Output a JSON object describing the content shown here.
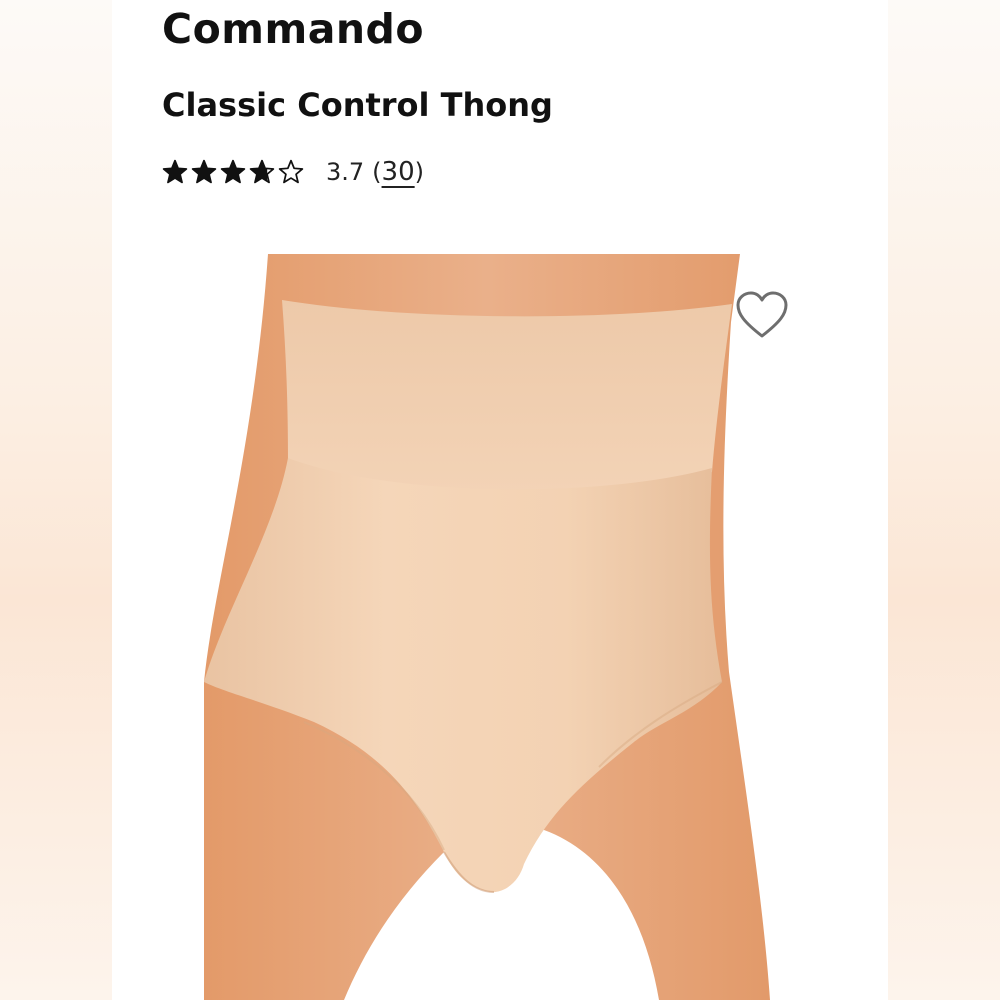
{
  "product": {
    "brand": "Commando",
    "name": "Classic Control Thong",
    "rating": {
      "value": "3.7",
      "stars_out_of_5": 3.7,
      "open_paren": "(",
      "count": "30",
      "close_paren": ")"
    },
    "image_icon": "product-photo",
    "wishlist_icon": "heart-outline-icon"
  },
  "colors": {
    "text": "#111111",
    "star": "#111111",
    "skin": "#e8a878",
    "fabric": "#f2cfae",
    "background": "#ffffff"
  }
}
